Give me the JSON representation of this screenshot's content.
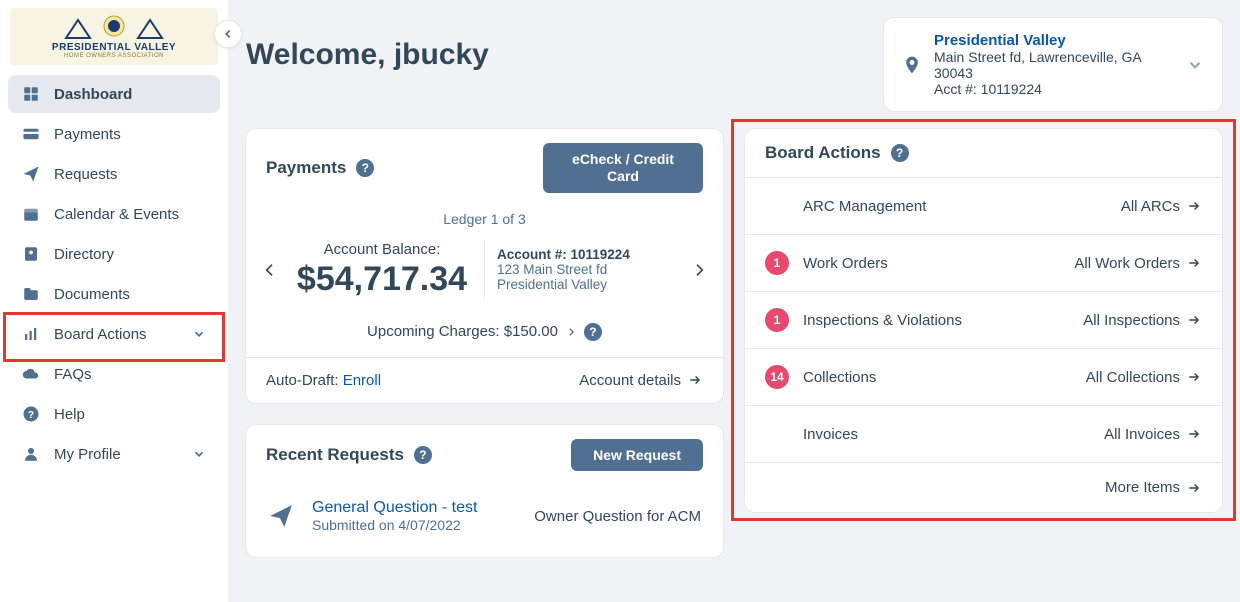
{
  "logo": {
    "name": "PRESIDENTIAL VALLEY",
    "sub": "HOME OWNERS ASSOCIATION"
  },
  "nav": {
    "dashboard": "Dashboard",
    "payments": "Payments",
    "requests": "Requests",
    "calendar": "Calendar & Events",
    "directory": "Directory",
    "documents": "Documents",
    "board_actions": "Board Actions",
    "faqs": "FAQs",
    "help": "Help",
    "my_profile": "My Profile"
  },
  "welcome": "Welcome, jbucky",
  "property": {
    "title": "Presidential Valley",
    "line1": "Main Street fd, Lawrenceville, GA 30043",
    "line2": "Acct #: 10119224"
  },
  "payments_card": {
    "title": "Payments",
    "button": "eCheck / Credit Card",
    "ledger": "Ledger 1 of 3",
    "balance_label": "Account Balance:",
    "balance": "$54,717.34",
    "acct_label": "Account #: 10119224",
    "addr1": "123 Main Street fd",
    "addr2": "Presidential Valley",
    "upcoming": "Upcoming Charges: $150.00",
    "autodraft_label": "Auto-Draft: ",
    "autodraft_action": "Enroll",
    "details": "Account details"
  },
  "requests_card": {
    "title": "Recent Requests",
    "button": "New Request",
    "item_title": "General Question - test",
    "item_sub": "Submitted on 4/07/2022",
    "item_right": "Owner Question for ACM"
  },
  "board_actions_card": {
    "title": "Board Actions",
    "items": [
      {
        "badge": "",
        "label": "ARC Management",
        "link": "All ARCs"
      },
      {
        "badge": "1",
        "label": "Work Orders",
        "link": "All Work Orders"
      },
      {
        "badge": "1",
        "label": "Inspections & Violations",
        "link": "All Inspections"
      },
      {
        "badge": "14",
        "label": "Collections",
        "link": "All Collections"
      },
      {
        "badge": "",
        "label": "Invoices",
        "link": "All Invoices"
      }
    ],
    "more": "More Items"
  }
}
